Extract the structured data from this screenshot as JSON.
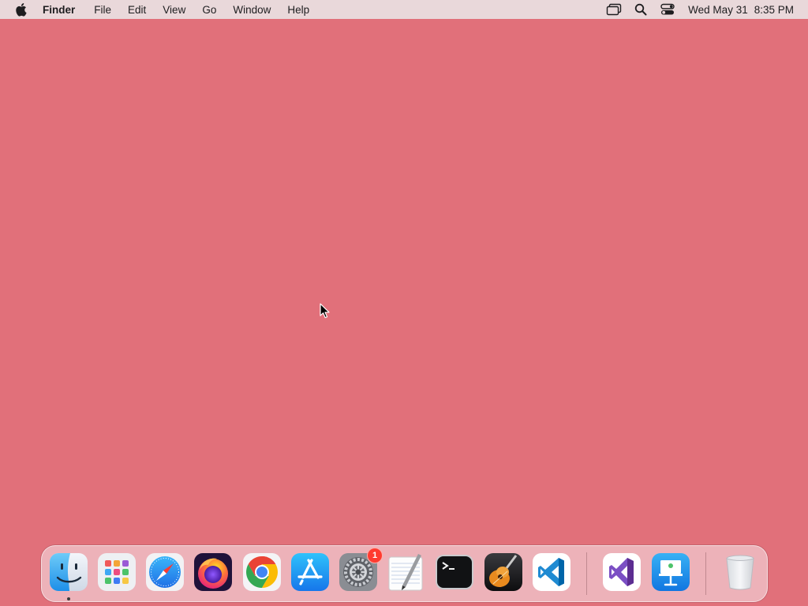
{
  "menubar": {
    "apple_icon": "apple-logo-icon",
    "app_name": "Finder",
    "menus": [
      "File",
      "Edit",
      "View",
      "Go",
      "Window",
      "Help"
    ],
    "status_icons": [
      "screen-mirroring-icon",
      "spotlight-search-icon",
      "control-center-icon"
    ],
    "date": "Wed May 31",
    "time": "8:35 PM"
  },
  "desktop": {
    "background_color": "#e1707a"
  },
  "dock": {
    "apps": [
      {
        "name": "Finder",
        "icon": "finder-icon",
        "running": true
      },
      {
        "name": "Launchpad",
        "icon": "launchpad-icon"
      },
      {
        "name": "Safari",
        "icon": "safari-icon"
      },
      {
        "name": "Firefox",
        "icon": "firefox-icon"
      },
      {
        "name": "Google Chrome",
        "icon": "chrome-icon"
      },
      {
        "name": "App Store",
        "icon": "app-store-icon"
      },
      {
        "name": "System Preferences",
        "icon": "system-preferences-icon",
        "badge": "1"
      },
      {
        "name": "TextEdit",
        "icon": "textedit-icon"
      },
      {
        "name": "Terminal",
        "icon": "terminal-icon"
      },
      {
        "name": "GarageBand",
        "icon": "garageband-icon"
      },
      {
        "name": "Visual Studio Code",
        "icon": "vscode-icon"
      },
      {
        "name": "Visual Studio",
        "icon": "visual-studio-icon"
      },
      {
        "name": "Keynote",
        "icon": "keynote-icon"
      },
      {
        "name": "Trash",
        "icon": "trash-icon"
      }
    ]
  }
}
